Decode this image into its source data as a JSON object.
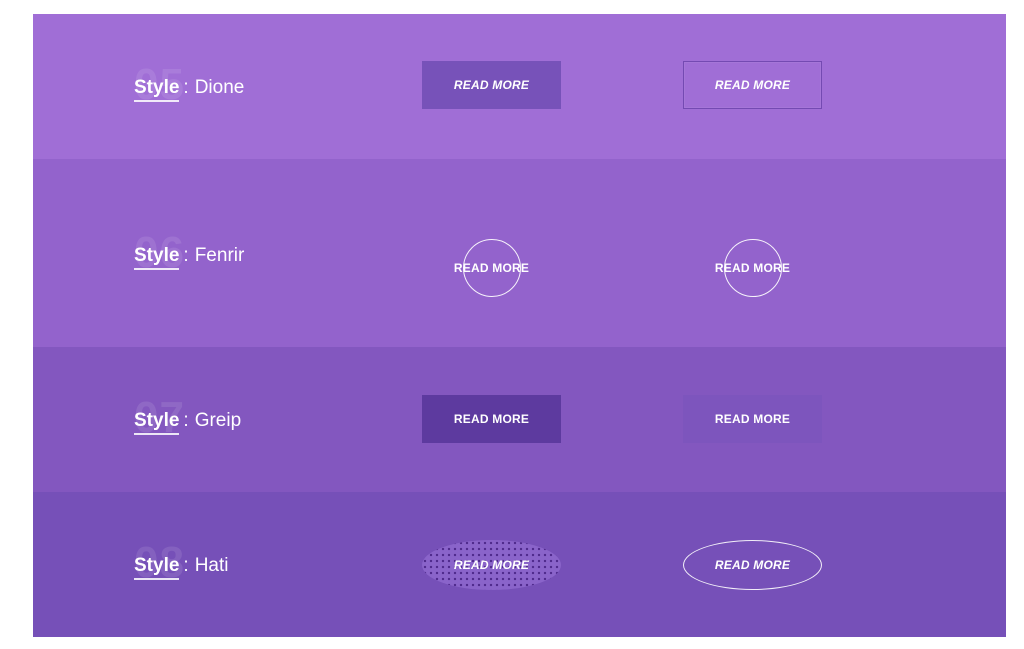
{
  "rows": [
    {
      "number": "05",
      "label_key": "Style",
      "label_colon": ":",
      "label_value": "Dione",
      "button_1": "READ MORE",
      "button_2": "READ MORE"
    },
    {
      "number": "06",
      "label_key": "Style",
      "label_colon": ":",
      "label_value": "Fenrir",
      "button_1": "READ MORE",
      "button_2": "READ MORE"
    },
    {
      "number": "07",
      "label_key": "Style",
      "label_colon": ":",
      "label_value": "Greip",
      "button_1": "READ MORE",
      "button_2": "READ MORE"
    },
    {
      "number": "08",
      "label_key": "Style",
      "label_colon": ":",
      "label_value": "Hati",
      "button_1": "READ MORE",
      "button_2": "READ MORE"
    }
  ],
  "colors": {
    "dione_band": "#a06ed6",
    "fenrir_band": "#9363cc",
    "greip_band": "#8357bf",
    "hati_band": "#7650b8",
    "text": "#ffffff"
  }
}
